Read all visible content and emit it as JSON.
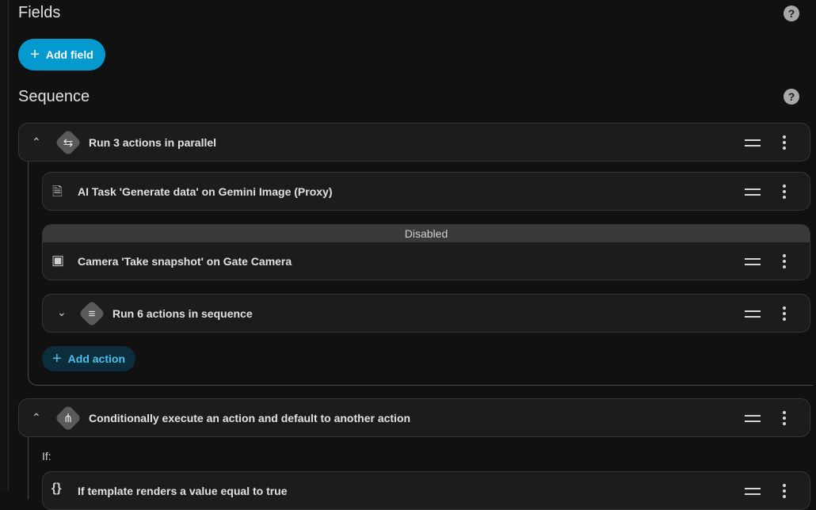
{
  "fields": {
    "title": "Fields",
    "add_label": "Add field",
    "help": "?"
  },
  "sequence": {
    "title": "Sequence",
    "help": "?",
    "parallel": {
      "label": "Run 3 actions in parallel",
      "children": {
        "ai_task": {
          "label": "AI Task 'Generate data' on Gemini Image (Proxy)"
        },
        "camera": {
          "status": "Disabled",
          "label": "Camera 'Take snapshot' on Gate Camera"
        },
        "sequence_action": {
          "label": "Run 6 actions in sequence"
        }
      },
      "add_action_label": "Add action"
    },
    "conditional": {
      "label": "Conditionally execute an action and default to another action",
      "if_label": "If:",
      "condition_label": "If template renders a value equal to true"
    }
  },
  "icons": {
    "help": "help-circle-icon",
    "plus": "plus-icon",
    "collapse": "chevron-up-icon",
    "expand": "chevron-down-icon",
    "parallel": "swap-arrows-icon",
    "ai_task": "file-star-icon",
    "camera": "camera-icon",
    "sequence": "list-icon",
    "conditional": "fork-icon",
    "drag": "drag-handle-icon",
    "menu": "dots-vertical-icon"
  },
  "colors": {
    "primary": "#049ad0",
    "background": "#111111",
    "card": "#1c1c1c",
    "disabled_bar": "#3a3a3a"
  }
}
